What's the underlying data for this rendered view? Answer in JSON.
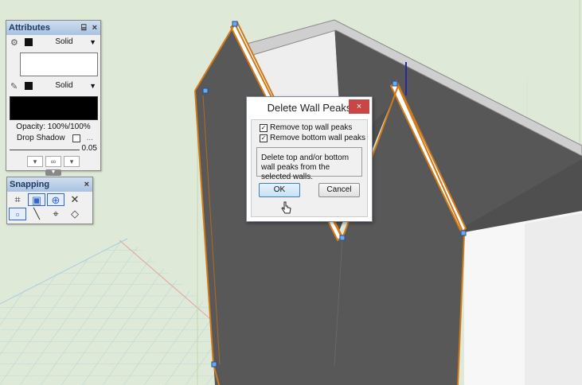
{
  "attributes_palette": {
    "title": "Attributes",
    "title_buttons": [
      "⌸",
      "×"
    ],
    "fill": {
      "style": "Solid",
      "color": "#ffffff",
      "swatch": "#111111",
      "icon": "paint-bucket-icon"
    },
    "pen": {
      "style": "Solid",
      "color": "#000000",
      "swatch": "#111111",
      "icon": "pen-icon"
    },
    "opacity": "Opacity: 100%/100%",
    "drop_shadow_label": "Drop Shadow",
    "drop_shadow_more": "...",
    "line_thickness": "0.05"
  },
  "snapping_palette": {
    "title": "Snapping",
    "close_glyph": "×",
    "buttons": [
      {
        "icon": "snap-grid-icon",
        "glyph": "⌗",
        "active": false
      },
      {
        "icon": "snap-object-icon",
        "glyph": "▣",
        "active": true
      },
      {
        "icon": "snap-angle-icon",
        "glyph": "⊕",
        "active": true
      },
      {
        "icon": "snap-intersection-icon",
        "glyph": "✕",
        "active": false
      },
      {
        "icon": "snap-distance-icon",
        "glyph": "▫",
        "active": true
      },
      {
        "icon": "snap-tangent-icon",
        "glyph": "╲",
        "active": false
      },
      {
        "icon": "snap-point-icon",
        "glyph": "⌖",
        "active": false
      },
      {
        "icon": "snap-surface-icon",
        "glyph": "◇",
        "active": false
      }
    ]
  },
  "dialog": {
    "title": "Delete Wall Peaks",
    "close_glyph": "×",
    "options": [
      {
        "label": "Remove top wall peaks",
        "checked": true
      },
      {
        "label": "Remove bottom wall peaks",
        "checked": true
      }
    ],
    "description": "Delete top and/or bottom wall peaks from the selected walls.",
    "ok_label": "OK",
    "cancel_label": "Cancel"
  },
  "colors": {
    "ground": "#dfe9d7",
    "wall_face": "#5a5a5a",
    "wall_top": "#ffffff",
    "selection": "#d07a1a",
    "handle": "#3a7bd5",
    "title_bar": "#a9c2e0"
  }
}
